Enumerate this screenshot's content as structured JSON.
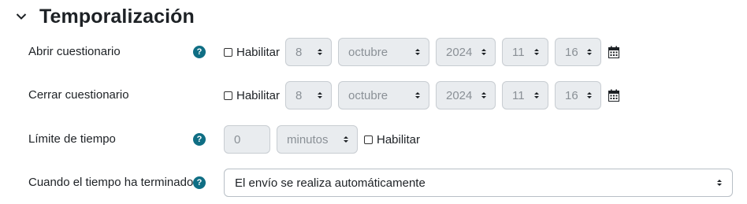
{
  "section": {
    "title": "Temporalización",
    "toggle_icon": "chevron-down-icon"
  },
  "open_quiz": {
    "label": "Abrir cuestionario",
    "enable_label": "Habilitar",
    "enabled": false,
    "day": "8",
    "month": "octubre",
    "year": "2024",
    "hour": "11",
    "minute": "16"
  },
  "close_quiz": {
    "label": "Cerrar cuestionario",
    "enable_label": "Habilitar",
    "enabled": false,
    "day": "8",
    "month": "octubre",
    "year": "2024",
    "hour": "11",
    "minute": "16"
  },
  "time_limit": {
    "label": "Límite de tiempo",
    "value": "0",
    "unit": "minutos",
    "enable_label": "Habilitar",
    "enabled": false
  },
  "when_time_expires": {
    "label": "Cuando el tiempo ha terminado",
    "selected": "El envío se realiza automáticamente"
  },
  "colors": {
    "help": "#0f6e84",
    "disabled_bg": "#e9ecef",
    "text": "#1d2125"
  }
}
